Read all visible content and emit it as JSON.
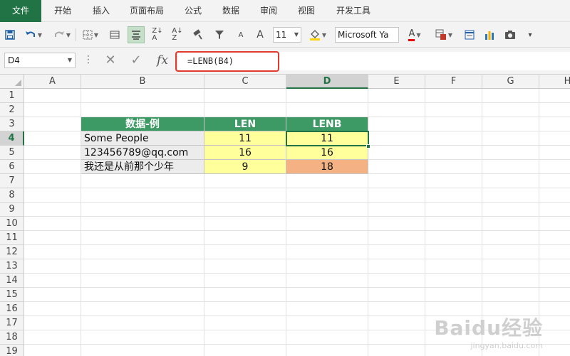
{
  "ribbon": {
    "tabs": [
      {
        "label": "文件",
        "active": true
      },
      {
        "label": "开始"
      },
      {
        "label": "插入"
      },
      {
        "label": "页面布局"
      },
      {
        "label": "公式"
      },
      {
        "label": "数据"
      },
      {
        "label": "审阅"
      },
      {
        "label": "视图"
      },
      {
        "label": "开发工具"
      }
    ]
  },
  "toolbar": {
    "font_size": "11",
    "font_name": "Microsoft Ya",
    "font_size_up": "A",
    "font_size_down": "A",
    "accent": "#217346"
  },
  "formula_bar": {
    "name_box": "D4",
    "formula": "=LENB(B4)",
    "fx_label": "fx"
  },
  "grid": {
    "columns": [
      "A",
      "B",
      "C",
      "D",
      "E",
      "F",
      "G",
      "H"
    ],
    "rows": [
      "1",
      "2",
      "3",
      "4",
      "5",
      "6",
      "7",
      "8",
      "9",
      "10",
      "11",
      "12",
      "13",
      "14",
      "15",
      "16",
      "17",
      "18",
      "19"
    ],
    "selected_column": "D",
    "selected_row": "4"
  },
  "table": {
    "headers": [
      "数据-例",
      "LEN",
      "LENB"
    ],
    "rows": [
      {
        "text": "Some People",
        "len": "11",
        "lenb": "11"
      },
      {
        "text": "123456789@qq.com",
        "len": "16",
        "lenb": "16"
      },
      {
        "text": "我还是从前那个少年",
        "len": "9",
        "lenb": "18"
      }
    ],
    "colors": {
      "header": "#3e9a64",
      "yellow": "#ffff9c",
      "orange": "#f4b183"
    }
  },
  "watermark": {
    "brand": "Baidu经验",
    "url": "jingyan.baidu.com"
  }
}
